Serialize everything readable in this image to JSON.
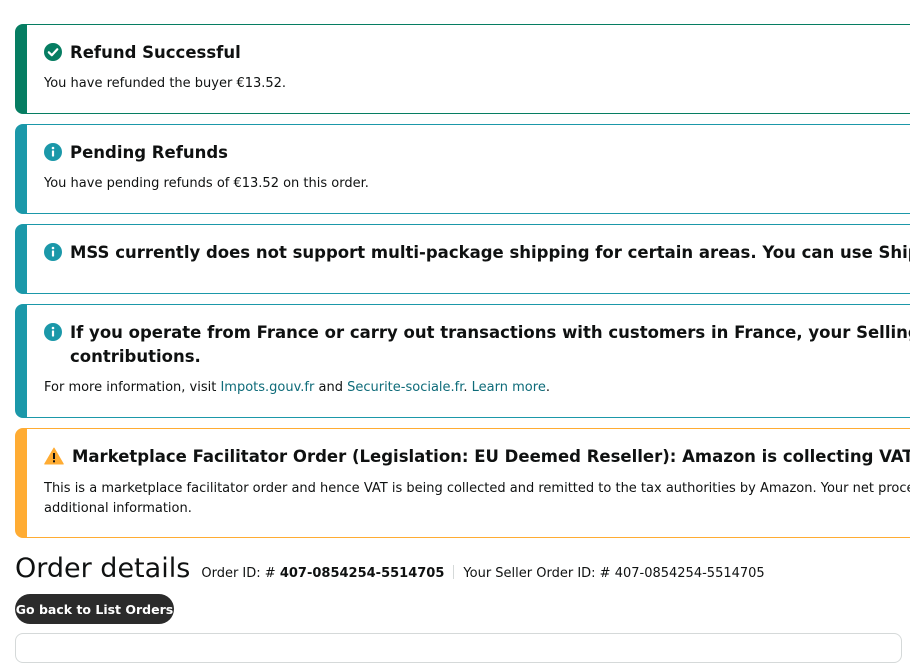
{
  "alerts": {
    "refund": {
      "title": "Refund Successful",
      "body": "You have refunded the buyer €13.52."
    },
    "pending": {
      "title": "Pending Refunds",
      "body": "You have pending refunds of €13.52 on this order."
    },
    "mss": {
      "title": "MSS currently does not support multi-package shipping for certain areas. You can use Ship Confirm"
    },
    "france": {
      "title_line1": "If you operate from France or carry out transactions with customers in France, your Selling on Amaz",
      "title_line2": "contributions.",
      "body_prefix": "For more information, visit ",
      "link1": "Impots.gouv.fr",
      "body_and": " and ",
      "link2": "Securite-sociale.fr",
      "body_dot": ". ",
      "link3": "Learn more",
      "body_end": "."
    },
    "marketplace": {
      "title": "Marketplace Facilitator Order (Legislation: EU Deemed Reseller): Amazon is collecting VAT on this tr",
      "body_line1": "This is a marketplace facilitator order and hence VAT is being collected and remitted to the tax authorities by Amazon. Your net proceeds",
      "body_line2": "additional information."
    }
  },
  "order": {
    "title": "Order details",
    "order_id_label": "Order ID: # ",
    "order_id": "407-0854254-5514705",
    "seller_order_id_label": "Your Seller Order ID: # ",
    "seller_order_id": "407-0854254-5514705",
    "back_button": "Go back to List Orders"
  },
  "colors": {
    "success": "#067d62",
    "info": "#1b98a9",
    "warning": "#ffac33",
    "link": "#0e6b79"
  },
  "icons": {
    "refund": "check-circle-icon",
    "info": "info-circle-icon",
    "warning": "warning-triangle-icon"
  }
}
